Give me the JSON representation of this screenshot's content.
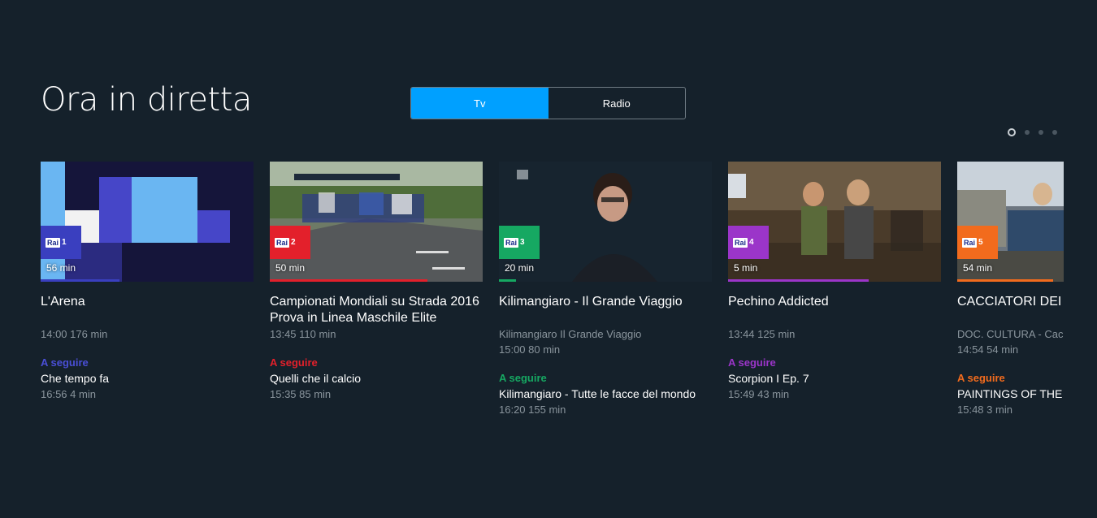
{
  "page_title": "Ora in diretta",
  "tabs": [
    {
      "label": "Tv",
      "active": true
    },
    {
      "label": "Radio",
      "active": false
    }
  ],
  "pagination": {
    "count": 4,
    "active": 0
  },
  "channels": [
    {
      "logo": "Rai",
      "number": "1",
      "color": "#3a3fbf",
      "duration": "56 min",
      "progress": 0.37,
      "title": "L'Arena",
      "subtitle": "",
      "meta": "14:00 176 min",
      "next_label": "A seguire",
      "next_title": "Che tempo fa",
      "next_meta": "16:56 4 min"
    },
    {
      "logo": "Rai",
      "number": "2",
      "color": "#e3202b",
      "duration": "50 min",
      "progress": 0.74,
      "title": "Campionati Mondiali su Strada 2016 Prova in Linea Maschile Elite",
      "subtitle": "",
      "meta": "13:45 110 min",
      "next_label": "A seguire",
      "next_title": "Quelli che il calcio",
      "next_meta": "15:35 85 min"
    },
    {
      "logo": "Rai",
      "number": "3",
      "color": "#16a862",
      "duration": "20 min",
      "progress": 0.08,
      "title": "Kilimangiaro - Il Grande Viaggio",
      "subtitle": "Kilimangiaro Il Grande Viaggio",
      "meta": "15:00 80 min",
      "next_label": "A seguire",
      "next_title": "Kilimangiaro - Tutte le facce del mondo",
      "next_meta": "16:20 155 min"
    },
    {
      "logo": "Rai",
      "number": "4",
      "color": "#9b35c9",
      "duration": "5 min",
      "progress": 0.66,
      "title": "Pechino Addicted",
      "subtitle": "",
      "meta": "13:44 125 min",
      "next_label": "A seguire",
      "next_title": "Scorpion I Ep. 7",
      "next_meta": "15:49 43 min"
    },
    {
      "logo": "Rai",
      "number": "5",
      "color": "#f26b1d",
      "duration": "54 min",
      "progress": 0.45,
      "title": "CACCIATORI DEI M",
      "subtitle": "DOC. CULTURA - Cacc",
      "meta": "14:54 54 min",
      "next_label": "A seguire",
      "next_title": "PAINTINGS OF THE V",
      "next_meta": "15:48 3 min"
    }
  ]
}
